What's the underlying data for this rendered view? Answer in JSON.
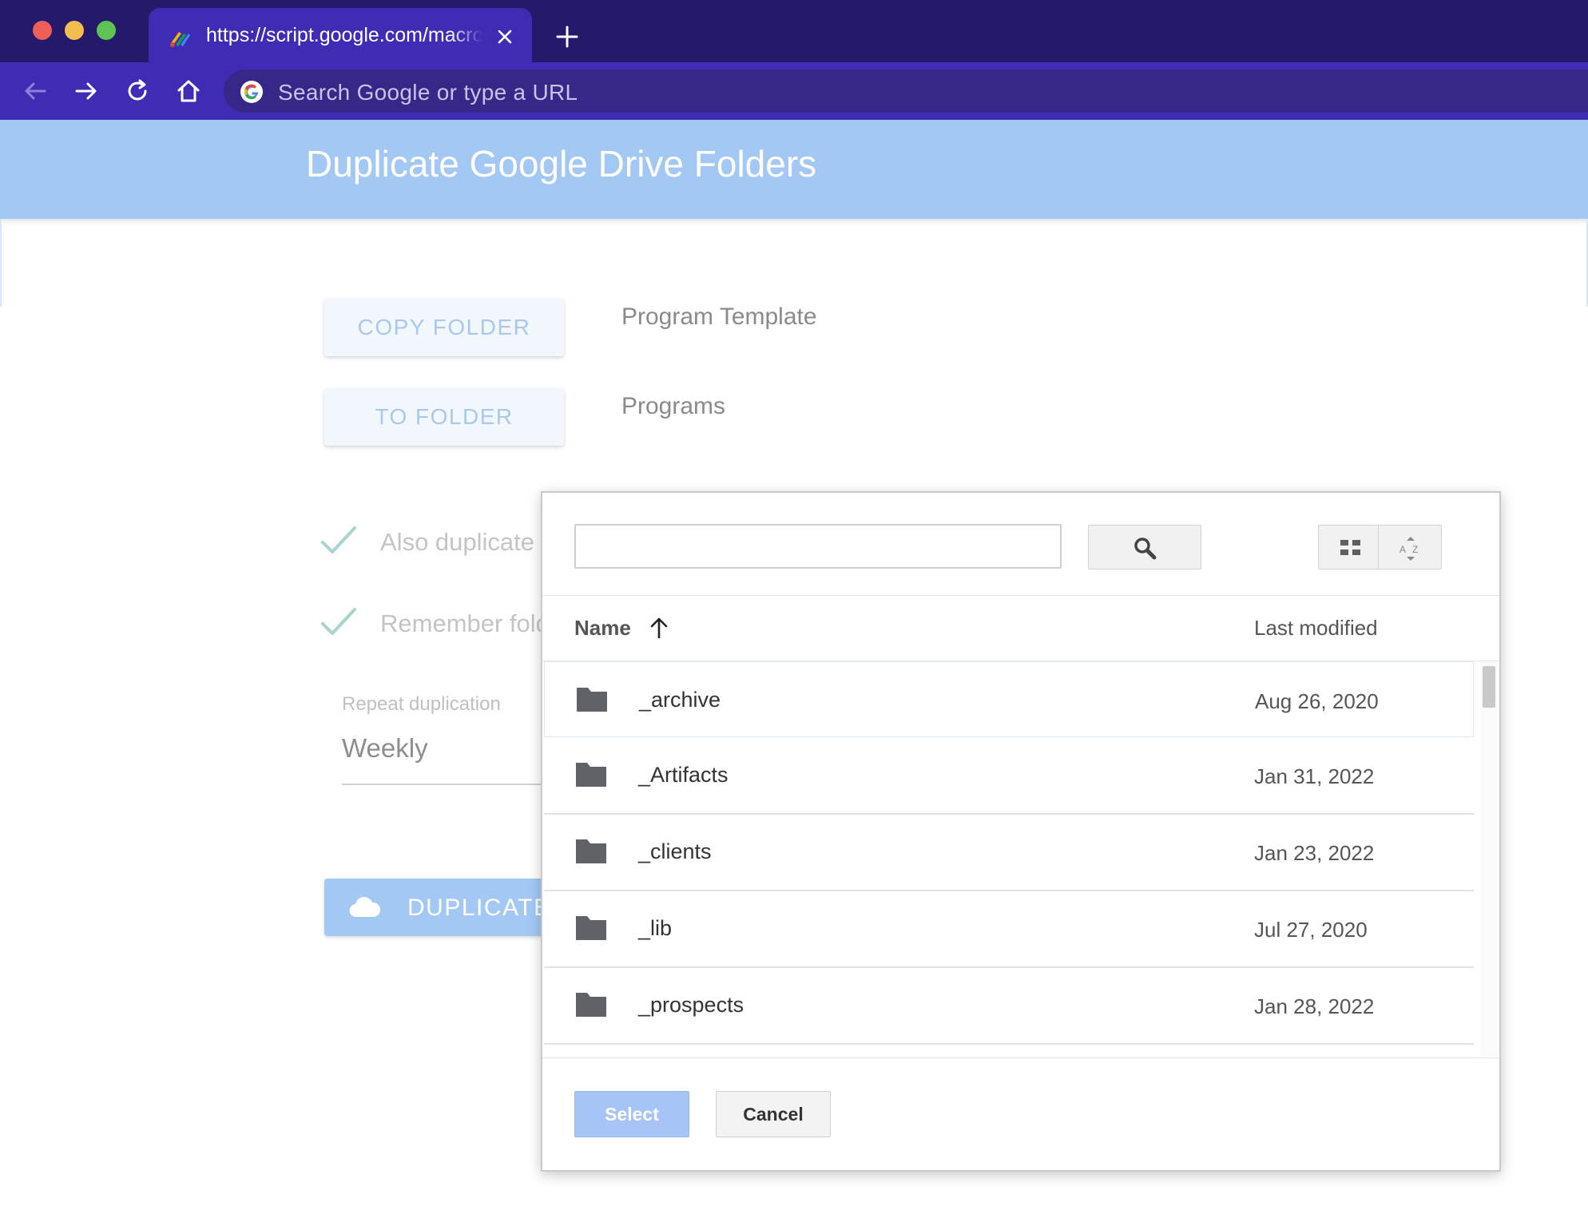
{
  "browser": {
    "tab_title": "https://script.google.com/macros/s/",
    "omnibox_placeholder": "Search Google or type a URL",
    "colors": {
      "tabbar": "#24196b",
      "toolbar": "#3f2cb5",
      "close": "#ee5f58",
      "minimize": "#f5bd4f",
      "zoom": "#5fc453"
    }
  },
  "app": {
    "title": "Duplicate Google Drive Folders",
    "copy_folder_button": "COPY FOLDER",
    "copy_folder_value": "Program Template",
    "to_folder_button": "TO FOLDER",
    "to_folder_value": "Programs",
    "options": [
      {
        "label": "Also duplicate",
        "checked": true
      },
      {
        "label": "Remember fold",
        "checked": true
      }
    ],
    "repeat_label": "Repeat duplication",
    "repeat_value": "Weekly",
    "duplicate_button": "DUPLICATE",
    "accent_color": "#a4c8f4"
  },
  "picker": {
    "search_value": "",
    "columns": {
      "name": "Name",
      "modified": "Last modified"
    },
    "rows": [
      {
        "name": "_archive",
        "modified": "Aug 26, 2020"
      },
      {
        "name": "_Artifacts",
        "modified": "Jan 31, 2022"
      },
      {
        "name": "_clients",
        "modified": "Jan 23, 2022"
      },
      {
        "name": "_lib",
        "modified": "Jul 27, 2020"
      },
      {
        "name": "_prospects",
        "modified": "Jan 28, 2022"
      }
    ],
    "select_button": "Select",
    "cancel_button": "Cancel"
  }
}
